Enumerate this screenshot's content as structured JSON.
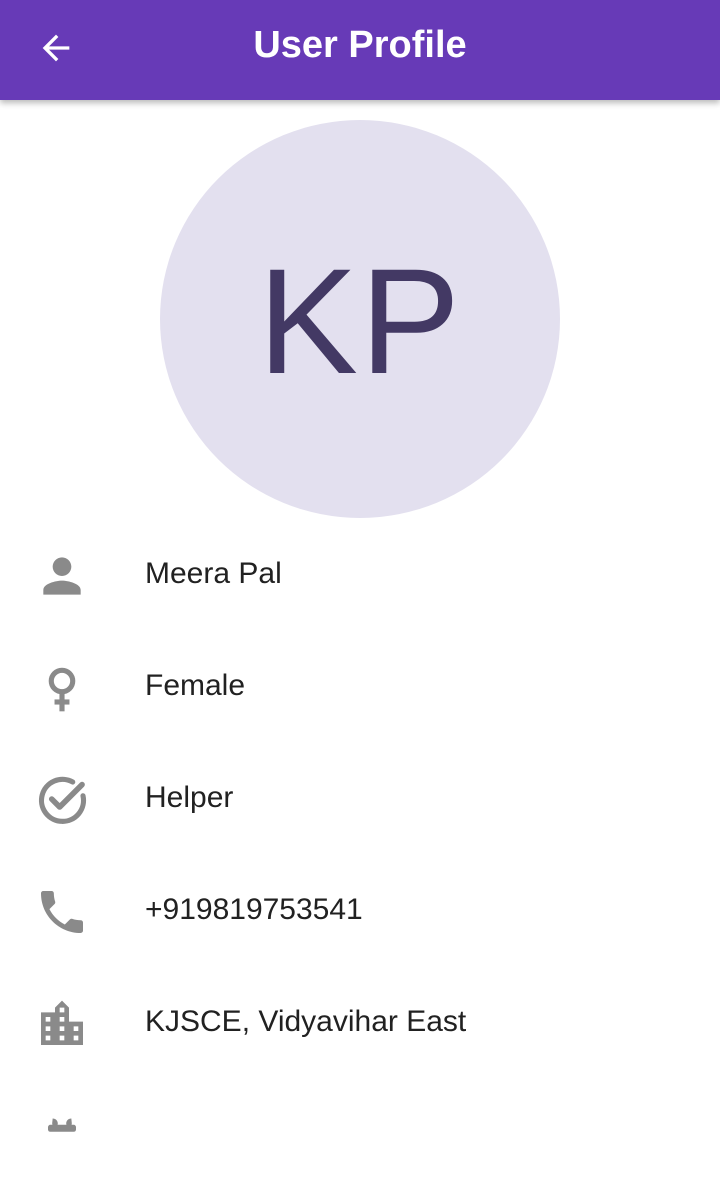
{
  "app_bar": {
    "title": "User Profile",
    "back_icon": "arrow-back-icon",
    "background_color": "#673ab7"
  },
  "avatar": {
    "initials": "KP",
    "background_color": "#e3e0ef",
    "text_color": "#433964"
  },
  "details": [
    {
      "icon": "person-icon",
      "text": "Meera Pal"
    },
    {
      "icon": "female-icon",
      "text": "Female"
    },
    {
      "icon": "check-circle-icon",
      "text": "Helper"
    },
    {
      "icon": "phone-icon",
      "text": "+919819753541"
    },
    {
      "icon": "building-icon",
      "text": "KJSCE, Vidyavihar East"
    },
    {
      "icon": "partial-icon",
      "text": ""
    }
  ]
}
